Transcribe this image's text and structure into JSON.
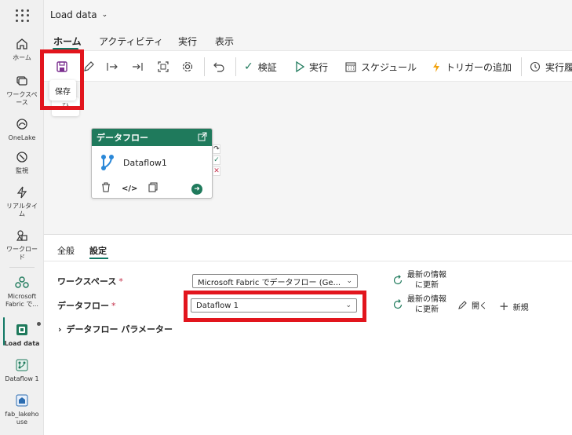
{
  "app": {
    "title": "Load data"
  },
  "leftnav": {
    "items": [
      {
        "label": "ホーム",
        "icon": "home-icon"
      },
      {
        "label": "ワークスペース",
        "icon": "workspaces-icon"
      },
      {
        "label": "OneLake",
        "icon": "onelake-icon"
      },
      {
        "label": "監視",
        "icon": "monitor-icon"
      },
      {
        "label": "リアルタイム",
        "icon": "realtime-icon"
      },
      {
        "label": "ワークロード",
        "icon": "workloads-icon"
      },
      {
        "label": "Microsoft Fabric で...",
        "icon": "workspace-icon"
      },
      {
        "label": "Load data",
        "icon": "pipeline-icon"
      },
      {
        "label": "Dataflow 1",
        "icon": "dataflow-icon"
      },
      {
        "label": "fab_lakehouse",
        "icon": "lakehouse-icon"
      }
    ]
  },
  "ribbon_tabs": [
    "ホーム",
    "アクティビティ",
    "実行",
    "表示"
  ],
  "toolbar": {
    "validate": "検証",
    "run": "実行",
    "schedule": "スケジュール",
    "add_trigger": "トリガーの追加",
    "run_history": "実行履"
  },
  "tooltip": {
    "text": "保存",
    "undo_hint": "ひ"
  },
  "activity": {
    "header": "データフロー",
    "name": "Dataflow1"
  },
  "panel": {
    "tabs": [
      "全般",
      "設定"
    ],
    "workspace_label": "ワークスペース",
    "workspace_value": "Microsoft Fabric でデータフロー (Ge...",
    "dataflow_label": "データフロー",
    "dataflow_value": "Dataflow 1",
    "required_mark": "*",
    "refresh_label_1": "最新の情報",
    "refresh_label_2": "に更新",
    "open_label": "開く",
    "new_label": "新規",
    "params_label": "データフロー パラメーター"
  },
  "colors": {
    "accent": "#117865",
    "header_green": "#1f7a5c",
    "highlight_red": "#e2151d"
  }
}
